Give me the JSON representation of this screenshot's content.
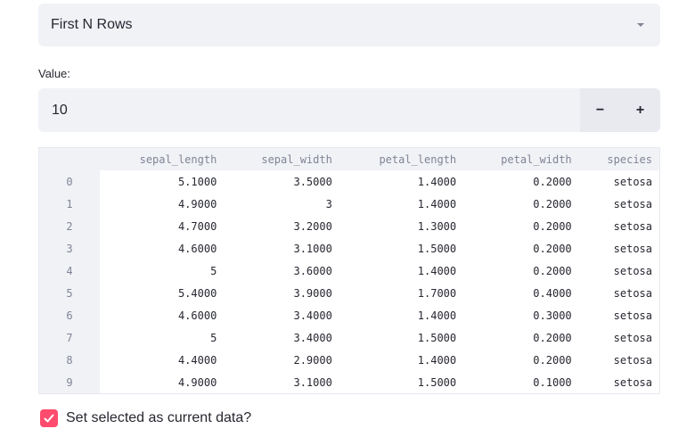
{
  "select": {
    "value": "First N Rows",
    "icon": "chevron-down-icon"
  },
  "number_input": {
    "label": "Value:",
    "value": "10",
    "decrement_label": "−",
    "increment_label": "+"
  },
  "table": {
    "columns": [
      "sepal_length",
      "sepal_width",
      "petal_length",
      "petal_width",
      "species"
    ],
    "rows": [
      {
        "index": "0",
        "cells": [
          "5.1000",
          "3.5000",
          "1.4000",
          "0.2000",
          "setosa"
        ]
      },
      {
        "index": "1",
        "cells": [
          "4.9000",
          "3",
          "1.4000",
          "0.2000",
          "setosa"
        ]
      },
      {
        "index": "2",
        "cells": [
          "4.7000",
          "3.2000",
          "1.3000",
          "0.2000",
          "setosa"
        ]
      },
      {
        "index": "3",
        "cells": [
          "4.6000",
          "3.1000",
          "1.5000",
          "0.2000",
          "setosa"
        ]
      },
      {
        "index": "4",
        "cells": [
          "5",
          "3.6000",
          "1.4000",
          "0.2000",
          "setosa"
        ]
      },
      {
        "index": "5",
        "cells": [
          "5.4000",
          "3.9000",
          "1.7000",
          "0.4000",
          "setosa"
        ]
      },
      {
        "index": "6",
        "cells": [
          "4.6000",
          "3.4000",
          "1.4000",
          "0.3000",
          "setosa"
        ]
      },
      {
        "index": "7",
        "cells": [
          "5",
          "3.4000",
          "1.5000",
          "0.2000",
          "setosa"
        ]
      },
      {
        "index": "8",
        "cells": [
          "4.4000",
          "2.9000",
          "1.4000",
          "0.2000",
          "setosa"
        ]
      },
      {
        "index": "9",
        "cells": [
          "4.9000",
          "3.1000",
          "1.5000",
          "0.1000",
          "setosa"
        ]
      }
    ]
  },
  "checkbox": {
    "label": "Set selected as current data?",
    "checked": true,
    "color": "#ff4b6e"
  },
  "colors": {
    "accent": "#ff4b6e",
    "input_bg": "#f0f2f6",
    "muted_text": "#808495"
  }
}
